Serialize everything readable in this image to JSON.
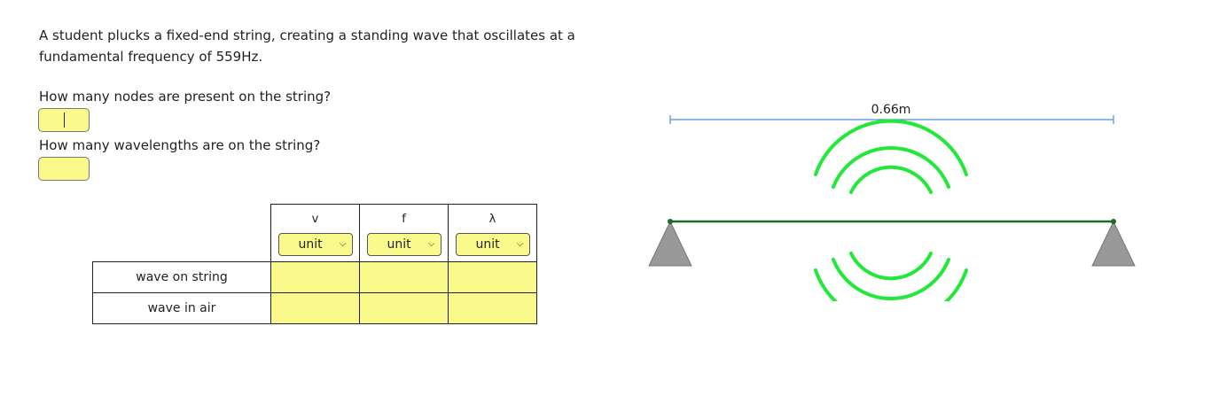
{
  "problem": {
    "text": "A student plucks a fixed-end string, creating a standing wave that oscillates at a fundamental frequency of 559Hz."
  },
  "questions": [
    {
      "label": "How many nodes are present on the string?",
      "value": ""
    },
    {
      "label": "How many wavelengths are on the string?",
      "value": ""
    }
  ],
  "table": {
    "columns": [
      {
        "symbol": "v",
        "unit": "unit"
      },
      {
        "symbol": "f",
        "unit": "unit"
      },
      {
        "symbol": "λ",
        "unit": "unit"
      }
    ],
    "rows": [
      {
        "label": "wave on string"
      },
      {
        "label": "wave in air"
      }
    ]
  },
  "diagram": {
    "length_label": "0.66m",
    "colors": {
      "string": "#1a6b2e",
      "waves": "#22e83a",
      "dimension": "#4a90d9",
      "support": "#999999"
    }
  }
}
